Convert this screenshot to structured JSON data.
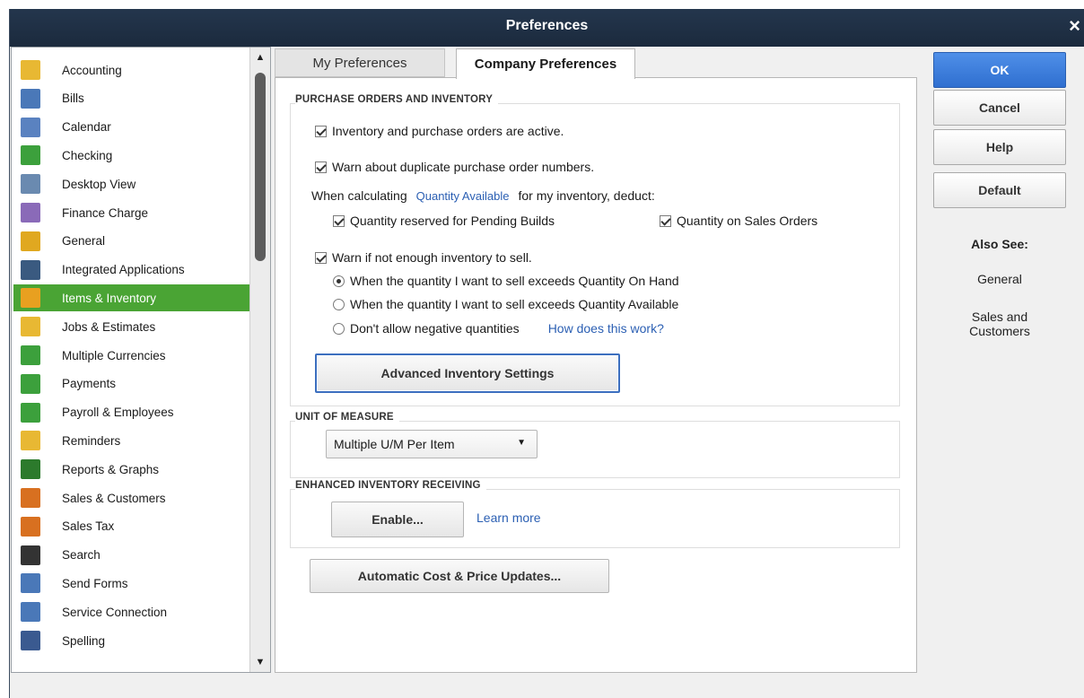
{
  "window": {
    "title": "Preferences",
    "close_glyph": "×"
  },
  "sidebar": {
    "scroll_up": "▲",
    "scroll_down": "▼",
    "items": [
      {
        "label": "Accounting",
        "icon": "accounting-icon",
        "color": "#e8b833"
      },
      {
        "label": "Bills",
        "icon": "bills-icon",
        "color": "#4a78b8"
      },
      {
        "label": "Calendar",
        "icon": "calendar-icon",
        "color": "#5a82c0"
      },
      {
        "label": "Checking",
        "icon": "checking-icon",
        "color": "#3ca03c"
      },
      {
        "label": "Desktop View",
        "icon": "desktop-view-icon",
        "color": "#6a8ab0"
      },
      {
        "label": "Finance Charge",
        "icon": "finance-charge-icon",
        "color": "#8a6ab8"
      },
      {
        "label": "General",
        "icon": "general-icon",
        "color": "#e0a820"
      },
      {
        "label": "Integrated Applications",
        "icon": "integrated-applications-icon",
        "color": "#3a5a80"
      },
      {
        "label": "Items & Inventory",
        "icon": "items-inventory-icon",
        "color": "#e8a020"
      },
      {
        "label": "Jobs & Estimates",
        "icon": "jobs-estimates-icon",
        "color": "#e8b833"
      },
      {
        "label": "Multiple Currencies",
        "icon": "multiple-currencies-icon",
        "color": "#3ca03c"
      },
      {
        "label": "Payments",
        "icon": "payments-icon",
        "color": "#3ca03c"
      },
      {
        "label": "Payroll & Employees",
        "icon": "payroll-employees-icon",
        "color": "#3ca03c"
      },
      {
        "label": "Reminders",
        "icon": "reminders-icon",
        "color": "#e8b833"
      },
      {
        "label": "Reports & Graphs",
        "icon": "reports-graphs-icon",
        "color": "#2c7a2c"
      },
      {
        "label": "Sales & Customers",
        "icon": "sales-customers-icon",
        "color": "#d87020"
      },
      {
        "label": "Sales Tax",
        "icon": "sales-tax-icon",
        "color": "#d87020"
      },
      {
        "label": "Search",
        "icon": "search-icon",
        "color": "#333333"
      },
      {
        "label": "Send Forms",
        "icon": "send-forms-icon",
        "color": "#4a78b8"
      },
      {
        "label": "Service Connection",
        "icon": "service-connection-icon",
        "color": "#4a78b8"
      },
      {
        "label": "Spelling",
        "icon": "spelling-icon",
        "color": "#3a5a90"
      }
    ],
    "selected_label": "Items & Inventory",
    "selected_color": "#4aa434"
  },
  "tabs": {
    "my_preferences": "My Preferences",
    "company_preferences": "Company Preferences",
    "active": "Company Preferences"
  },
  "purchase_orders": {
    "section_title": "PURCHASE ORDERS AND INVENTORY",
    "inventory_active": {
      "label": "Inventory and purchase orders are active.",
      "checked": true
    },
    "warn_duplicate": {
      "label": "Warn about duplicate purchase order numbers.",
      "checked": true
    },
    "calc_prefix": "When calculating",
    "calc_link": "Quantity Available",
    "calc_suffix": "for my inventory, deduct:",
    "reserved_builds": {
      "label": "Quantity reserved for Pending Builds",
      "checked": true
    },
    "sales_orders": {
      "label": "Quantity on Sales Orders",
      "checked": true
    },
    "warn_not_enough": {
      "label": "Warn if not enough inventory to sell.",
      "checked": true
    },
    "radio_on_hand": {
      "label": "When the quantity I want to sell exceeds Quantity On Hand",
      "checked": true
    },
    "radio_available": {
      "label": "When the quantity I want to sell exceeds Quantity Available",
      "checked": false
    },
    "radio_no_negative": {
      "label": "Don't allow negative quantities",
      "checked": false
    },
    "how_link": "How does this work?",
    "advanced_button": "Advanced Inventory Settings"
  },
  "unit_of_measure": {
    "section_title": "UNIT OF MEASURE",
    "selected": "Multiple U/M Per Item",
    "arrow": "▼"
  },
  "enhanced_receiving": {
    "section_title": "ENHANCED INVENTORY RECEIVING",
    "enable_button": "Enable...",
    "learn_more": "Learn more"
  },
  "auto_cost_button": "Automatic Cost & Price Updates...",
  "actions": {
    "ok": "OK",
    "cancel": "Cancel",
    "help": "Help",
    "default": "Default",
    "primary_color": "#2f6fd0"
  },
  "also_see": {
    "heading": "Also See:",
    "general": "General",
    "sales_customers": "Sales and Customers"
  }
}
